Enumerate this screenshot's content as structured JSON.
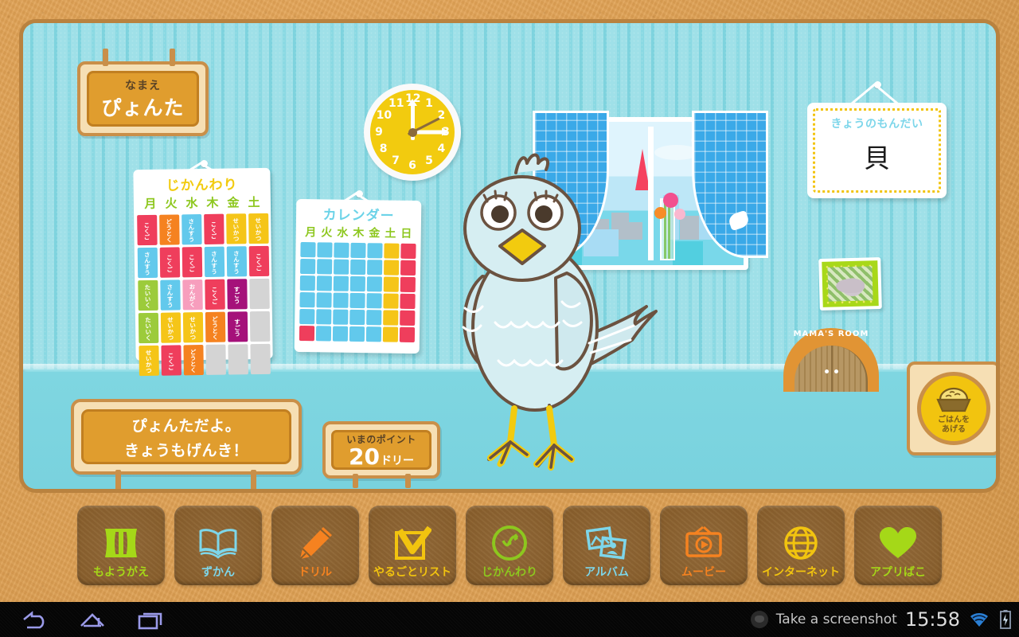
{
  "app": {
    "character_name_label": "なまえ",
    "character_name": "ぴょんた",
    "speech_line_1": "ぴょんただよ。",
    "speech_line_2": "きょうもげんき！",
    "points_label": "いまのポイント",
    "points_value": "20",
    "points_unit": "ドリー",
    "feed_line_1": "ごはんを",
    "feed_line_2": "あげる",
    "door_label": "MAMA'S ROOM"
  },
  "problem": {
    "title": "きょうのもんだい",
    "kanji": "貝"
  },
  "timetable": {
    "title": "じかんわり",
    "days": [
      "月",
      "火",
      "水",
      "木",
      "金",
      "土"
    ],
    "rows": [
      [
        {
          "subject": "こくご",
          "color": "#ef3e5c"
        },
        {
          "subject": "どうとく",
          "color": "#f58220"
        },
        {
          "subject": "さんすう",
          "color": "#62c9ec"
        },
        {
          "subject": "こくご",
          "color": "#ef3e5c"
        },
        {
          "subject": "せいかつ",
          "color": "#f5c518"
        },
        {
          "subject": "せいかつ",
          "color": "#f5c518"
        }
      ],
      [
        {
          "subject": "さんすう",
          "color": "#62c9ec"
        },
        {
          "subject": "こくご",
          "color": "#ef3e5c"
        },
        {
          "subject": "こくご",
          "color": "#ef3e5c"
        },
        {
          "subject": "さんすう",
          "color": "#62c9ec"
        },
        {
          "subject": "さんすう",
          "color": "#62c9ec"
        },
        {
          "subject": "こくご",
          "color": "#ef3e5c"
        }
      ],
      [
        {
          "subject": "たいいく",
          "color": "#9ccb3b"
        },
        {
          "subject": "さんすう",
          "color": "#62c9ec"
        },
        {
          "subject": "おんがく",
          "color": "#f79ebd"
        },
        {
          "subject": "こくご",
          "color": "#ef3e5c"
        },
        {
          "subject": "すごう",
          "color": "#a5117a"
        },
        {
          "subject": "",
          "color": "#d4d4d4"
        }
      ],
      [
        {
          "subject": "たいいく",
          "color": "#9ccb3b"
        },
        {
          "subject": "せいかつ",
          "color": "#f5c518"
        },
        {
          "subject": "せいかつ",
          "color": "#f5c518"
        },
        {
          "subject": "どうとく",
          "color": "#f58220"
        },
        {
          "subject": "すごう",
          "color": "#a5117a"
        },
        {
          "subject": "",
          "color": "#d4d4d4"
        }
      ],
      [
        {
          "subject": "せいかつ",
          "color": "#f5c518"
        },
        {
          "subject": "こくご",
          "color": "#ef3e5c"
        },
        {
          "subject": "どうとく",
          "color": "#f58220"
        },
        {
          "subject": "",
          "color": "#d4d4d4"
        },
        {
          "subject": "",
          "color": "#d4d4d4"
        },
        {
          "subject": "",
          "color": "#d4d4d4"
        }
      ]
    ]
  },
  "calendar": {
    "title": "カレンダー",
    "days": [
      "月",
      "火",
      "水",
      "木",
      "金",
      "土",
      "日"
    ],
    "weekday_color": "#62c9ec",
    "saturday_color": "#f5c518",
    "sunday_color": "#ef3e5c",
    "rows": [
      [
        "#62c9ec",
        "#62c9ec",
        "#62c9ec",
        "#62c9ec",
        "#62c9ec",
        "#f5c518",
        "#ef3e5c"
      ],
      [
        "#62c9ec",
        "#62c9ec",
        "#62c9ec",
        "#62c9ec",
        "#62c9ec",
        "#f5c518",
        "#ef3e5c"
      ],
      [
        "#62c9ec",
        "#62c9ec",
        "#62c9ec",
        "#62c9ec",
        "#62c9ec",
        "#f5c518",
        "#ef3e5c"
      ],
      [
        "#62c9ec",
        "#62c9ec",
        "#62c9ec",
        "#62c9ec",
        "#62c9ec",
        "#f5c518",
        "#ef3e5c"
      ],
      [
        "#62c9ec",
        "#62c9ec",
        "#62c9ec",
        "#62c9ec",
        "#62c9ec",
        "#f5c518",
        "#ef3e5c"
      ],
      [
        "#ef3e5c",
        "#62c9ec",
        "#62c9ec",
        "#62c9ec",
        "#62c9ec",
        "#f5c518",
        "#ef3e5c"
      ]
    ]
  },
  "clock": {
    "numbers": [
      "12",
      "1",
      "2",
      "3",
      "4",
      "5",
      "6",
      "7",
      "8",
      "9",
      "10",
      "11"
    ],
    "hour_hand_angle": 0,
    "minute_hand_angle": 0,
    "second_hand_angle": -27,
    "face_color": "#f2cb0f"
  },
  "menu": [
    {
      "label": "もようがえ",
      "icon": "curtain-icon",
      "color": "#a5d818"
    },
    {
      "label": "ずかん",
      "icon": "book-icon",
      "color": "#7dd6ea"
    },
    {
      "label": "ドリル",
      "icon": "pencil-icon",
      "color": "#f58220"
    },
    {
      "label": "やるごとリスト",
      "icon": "checkbox-icon",
      "color": "#f2c40f"
    },
    {
      "label": "じかんわり",
      "icon": "clock-icon",
      "color": "#8dc71e"
    },
    {
      "label": "アルバム",
      "icon": "photos-icon",
      "color": "#7dd6ea"
    },
    {
      "label": "ムービー",
      "icon": "tv-icon",
      "color": "#f58220"
    },
    {
      "label": "インターネット",
      "icon": "globe-icon",
      "color": "#f2c40f"
    },
    {
      "label": "アプリばこ",
      "icon": "heart-icon",
      "color": "#a5d818"
    }
  ],
  "system_bar": {
    "back_icon": "back-icon",
    "home_icon": "home-icon",
    "recents_icon": "recents-icon",
    "notification_text": "Take a screenshot",
    "clock": "15:58",
    "wifi_icon": "wifi-icon",
    "battery_icon": "battery-charging-icon"
  }
}
